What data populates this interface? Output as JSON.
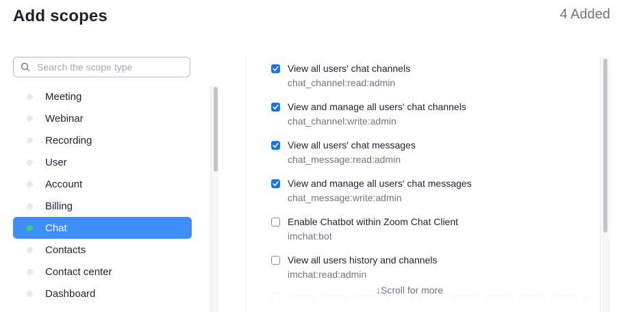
{
  "header": {
    "title": "Add scopes",
    "added_count": "4 Added"
  },
  "search": {
    "placeholder": "Search the scope type"
  },
  "categories": [
    {
      "label": "Meeting",
      "active": false
    },
    {
      "label": "Webinar",
      "active": false
    },
    {
      "label": "Recording",
      "active": false
    },
    {
      "label": "User",
      "active": false
    },
    {
      "label": "Account",
      "active": false
    },
    {
      "label": "Billing",
      "active": false
    },
    {
      "label": "Chat",
      "active": true
    },
    {
      "label": "Contacts",
      "active": false
    },
    {
      "label": "Contact center",
      "active": false
    },
    {
      "label": "Dashboard",
      "active": false
    }
  ],
  "scopes": [
    {
      "label": "View all users' chat channels",
      "code": "chat_channel:read:admin",
      "checked": true
    },
    {
      "label": "View and manage all users' chat channels",
      "code": "chat_channel:write:admin",
      "checked": true
    },
    {
      "label": "View all users' chat messages",
      "code": "chat_message:read:admin",
      "checked": true
    },
    {
      "label": "View and manage all users' chat messages",
      "code": "chat_message:write:admin",
      "checked": true
    },
    {
      "label": "Enable Chatbot within Zoom Chat Client",
      "code": "imchat:bot",
      "checked": false
    },
    {
      "label": "View all users history and channels",
      "code": "imchat:read:admin",
      "checked": false
    }
  ],
  "scroll_hint": "↓Scroll for more",
  "colors": {
    "accent": "#3d8ef8",
    "checkbox": "#1a73e8",
    "active_dot": "#3bcf6e"
  },
  "icons": {
    "search": "search-icon",
    "check": "check-icon"
  }
}
